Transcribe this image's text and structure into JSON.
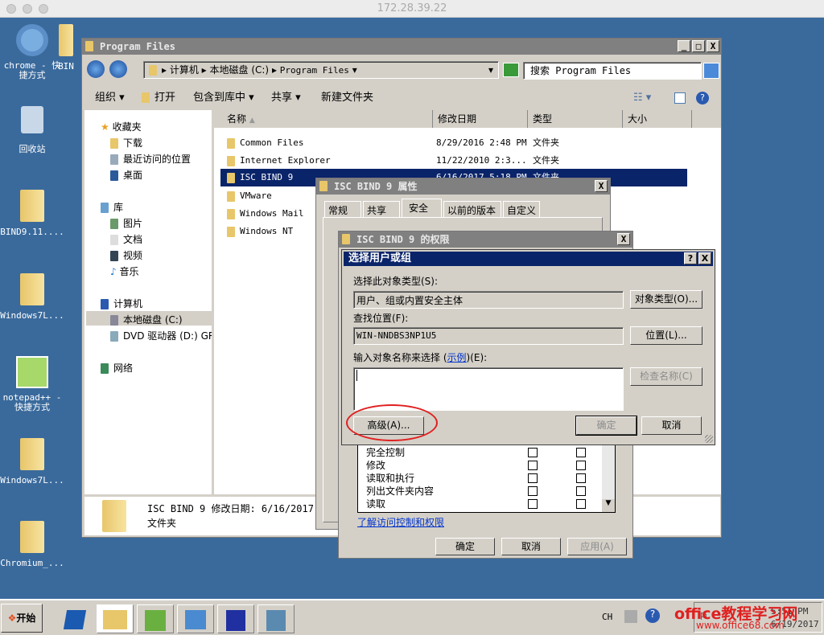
{
  "mac": {
    "title": "172.28.39.22"
  },
  "desktop": {
    "icons": [
      {
        "label": "chrome - 快捷方式"
      },
      {
        "label": "回收站"
      },
      {
        "label": "BIND9.11...."
      },
      {
        "label": "Windows7L..."
      },
      {
        "label": "notepad++ - 快捷方式"
      },
      {
        "label": "Windows7L..."
      },
      {
        "label": "Chromium_..."
      },
      {
        "label": "BIN"
      }
    ]
  },
  "explorer": {
    "title": "Program Files",
    "breadcrumb": [
      "计算机",
      "本地磁盘 (C:)",
      "Program Files"
    ],
    "search_placeholder": "搜索 Program Files",
    "toolbar": {
      "organize": "组织",
      "open": "打开",
      "include": "包含到库中",
      "share": "共享",
      "new_folder": "新建文件夹"
    },
    "sidebar": {
      "favorites": "收藏夹",
      "fav_items": [
        "下载",
        "最近访问的位置",
        "桌面"
      ],
      "libraries": "库",
      "lib_items": [
        "图片",
        "文档",
        "视频",
        "音乐"
      ],
      "computer": "计算机",
      "comp_items": [
        "本地磁盘 (C:)",
        "DVD 驱动器 (D:) GR"
      ],
      "network": "网络"
    },
    "columns": [
      "名称",
      "修改日期",
      "类型",
      "大小"
    ],
    "rows": [
      {
        "name": "Common Files",
        "date": "8/29/2016 2:48 PM",
        "type": "文件夹"
      },
      {
        "name": "Internet Explorer",
        "date": "11/22/2010 2:3...",
        "type": "文件夹"
      },
      {
        "name": "ISC BIND 9",
        "date": "6/16/2017 5:18 PM",
        "type": "文件夹"
      },
      {
        "name": "VMware",
        "date": "",
        "type": ""
      },
      {
        "name": "Windows Mail",
        "date": "",
        "type": ""
      },
      {
        "name": "Windows NT",
        "date": "",
        "type": ""
      }
    ],
    "status": {
      "line1": "ISC BIND 9 修改日期: 6/16/2017 5:1",
      "line2": "文件夹"
    }
  },
  "props": {
    "title": "ISC BIND 9 属性",
    "tabs": [
      "常规",
      "共享",
      "安全",
      "以前的版本",
      "自定义"
    ],
    "active_tab": "安全"
  },
  "perm": {
    "title": "ISC BIND 9 的权限",
    "items": [
      "完全控制",
      "修改",
      "读取和执行",
      "列出文件夹内容",
      "读取"
    ],
    "link": "了解访问控制和权限",
    "ok": "确定",
    "cancel": "取消",
    "apply": "应用(A)"
  },
  "select": {
    "title": "选择用户或组",
    "help": "?",
    "type_label": "选择此对象类型(S):",
    "type_value": "用户、组或内置安全主体",
    "type_btn": "对象类型(O)...",
    "loc_label": "查找位置(F):",
    "loc_value": "WIN-NNDBS3NP1U5",
    "loc_btn": "位置(L)...",
    "name_label_pre": "输入对象名称来选择 (",
    "name_label_link": "示例",
    "name_label_post": ")(E):",
    "name_value": "",
    "check_btn": "检查名称(C)",
    "advanced_btn": "高级(A)...",
    "ok": "确定",
    "cancel": "取消"
  },
  "taskbar": {
    "start": "开始",
    "lang": "CH",
    "time": "5:51 PM",
    "date": "6/19/2017"
  },
  "watermark": {
    "line1": "office教程学习网",
    "line2": "www.office68.com"
  },
  "colors": {
    "desktop": "#3a6a9c",
    "titlebar_active": "#0a246a",
    "highlight": "#0a246a",
    "annotation": "#e02020"
  }
}
